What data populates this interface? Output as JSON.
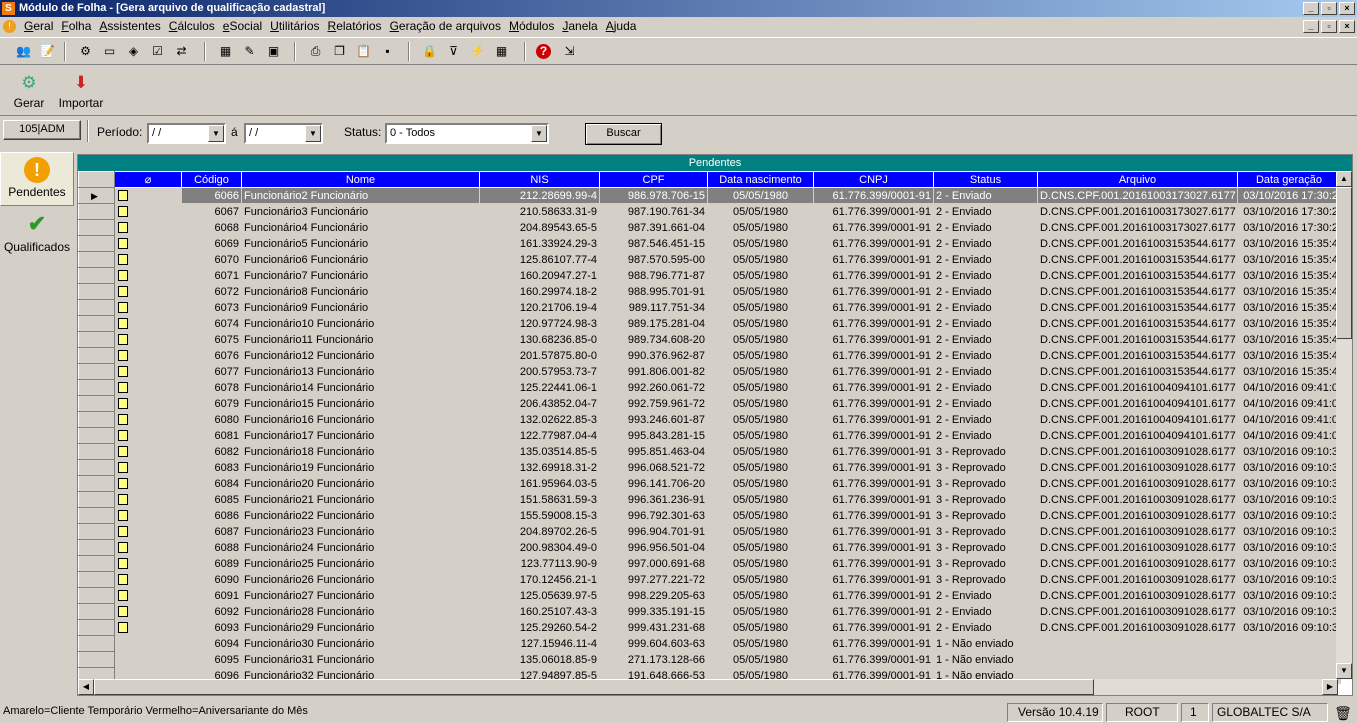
{
  "window": {
    "title": "Módulo de Folha - [Gera arquivo de qualificação cadastral]"
  },
  "menu": [
    "Geral",
    "Folha",
    "Assistentes",
    "Cálculos",
    "eSocial",
    "Utilitários",
    "Relatórios",
    "Geração de arquivos",
    "Módulos",
    "Janela",
    "Ajuda"
  ],
  "toolbar_icons": [
    "users-icon",
    "notes-icon",
    "settings-icon",
    "window-icon",
    "tag-icon",
    "check-doc-icon",
    "transfer-icon",
    "calendar-icon",
    "ruler-icon",
    "briefcase-icon",
    "printer-icon",
    "copy-icon",
    "paste-icon",
    "disk-icon",
    "lock-icon",
    "filter-icon",
    "lightning-icon",
    "grid-icon",
    "help-icon",
    "exit-icon"
  ],
  "actions": {
    "generate_label": "Gerar",
    "import_label": "Importar"
  },
  "filters": {
    "company_code": "105|ADM",
    "period_label": "Período:",
    "period_start": "/ /",
    "period_separator": "á",
    "period_end": "/ /",
    "status_label": "Status:",
    "status_value": "0 - Todos",
    "search_button": "Buscar"
  },
  "sidebar": {
    "pending_label": "Pendentes",
    "qualified_label": "Qualificados"
  },
  "grid": {
    "title": "Pendentes",
    "columns": [
      "Código",
      "Nome",
      "NIS",
      "CPF",
      "Data nascimento",
      "CNPJ",
      "Status",
      "Arquivo",
      "Data geração"
    ],
    "rows": [
      {
        "code": "6066",
        "name": "Funcionário2 Funcionário",
        "nis": "212.28699.99-4",
        "cpf": "986.978.706-15",
        "birth": "05/05/1980",
        "cnpj": "61.776.399/0001-91",
        "status": "2 - Enviado",
        "file": "D.CNS.CPF.001.20161003173027.6177",
        "gen": "03/10/2016 17:30:2",
        "icon": true
      },
      {
        "code": "6067",
        "name": "Funcionário3 Funcionário",
        "nis": "210.58633.31-9",
        "cpf": "987.190.761-34",
        "birth": "05/05/1980",
        "cnpj": "61.776.399/0001-91",
        "status": "2 - Enviado",
        "file": "D.CNS.CPF.001.20161003173027.6177",
        "gen": "03/10/2016 17:30:2",
        "icon": true
      },
      {
        "code": "6068",
        "name": "Funcionário4 Funcionário",
        "nis": "204.89543.65-5",
        "cpf": "987.391.661-04",
        "birth": "05/05/1980",
        "cnpj": "61.776.399/0001-91",
        "status": "2 - Enviado",
        "file": "D.CNS.CPF.001.20161003173027.6177",
        "gen": "03/10/2016 17:30:2",
        "icon": true
      },
      {
        "code": "6069",
        "name": "Funcionário5 Funcionário",
        "nis": "161.33924.29-3",
        "cpf": "987.546.451-15",
        "birth": "05/05/1980",
        "cnpj": "61.776.399/0001-91",
        "status": "2 - Enviado",
        "file": "D.CNS.CPF.001.20161003153544.6177",
        "gen": "03/10/2016 15:35:4",
        "icon": true
      },
      {
        "code": "6070",
        "name": "Funcionário6 Funcionário",
        "nis": "125.86107.77-4",
        "cpf": "987.570.595-00",
        "birth": "05/05/1980",
        "cnpj": "61.776.399/0001-91",
        "status": "2 - Enviado",
        "file": "D.CNS.CPF.001.20161003153544.6177",
        "gen": "03/10/2016 15:35:4",
        "icon": true
      },
      {
        "code": "6071",
        "name": "Funcionário7 Funcionário",
        "nis": "160.20947.27-1",
        "cpf": "988.796.771-87",
        "birth": "05/05/1980",
        "cnpj": "61.776.399/0001-91",
        "status": "2 - Enviado",
        "file": "D.CNS.CPF.001.20161003153544.6177",
        "gen": "03/10/2016 15:35:4",
        "icon": true
      },
      {
        "code": "6072",
        "name": "Funcionário8 Funcionário",
        "nis": "160.29974.18-2",
        "cpf": "988.995.701-91",
        "birth": "05/05/1980",
        "cnpj": "61.776.399/0001-91",
        "status": "2 - Enviado",
        "file": "D.CNS.CPF.001.20161003153544.6177",
        "gen": "03/10/2016 15:35:4",
        "icon": true
      },
      {
        "code": "6073",
        "name": "Funcionário9 Funcionário",
        "nis": "120.21706.19-4",
        "cpf": "989.117.751-34",
        "birth": "05/05/1980",
        "cnpj": "61.776.399/0001-91",
        "status": "2 - Enviado",
        "file": "D.CNS.CPF.001.20161003153544.6177",
        "gen": "03/10/2016 15:35:4",
        "icon": true
      },
      {
        "code": "6074",
        "name": "Funcionário10 Funcionário",
        "nis": "120.97724.98-3",
        "cpf": "989.175.281-04",
        "birth": "05/05/1980",
        "cnpj": "61.776.399/0001-91",
        "status": "2 - Enviado",
        "file": "D.CNS.CPF.001.20161003153544.6177",
        "gen": "03/10/2016 15:35:4",
        "icon": true
      },
      {
        "code": "6075",
        "name": "Funcionário11 Funcionário",
        "nis": "130.68236.85-0",
        "cpf": "989.734.608-20",
        "birth": "05/05/1980",
        "cnpj": "61.776.399/0001-91",
        "status": "2 - Enviado",
        "file": "D.CNS.CPF.001.20161003153544.6177",
        "gen": "03/10/2016 15:35:4",
        "icon": true
      },
      {
        "code": "6076",
        "name": "Funcionário12 Funcionário",
        "nis": "201.57875.80-0",
        "cpf": "990.376.962-87",
        "birth": "05/05/1980",
        "cnpj": "61.776.399/0001-91",
        "status": "2 - Enviado",
        "file": "D.CNS.CPF.001.20161003153544.6177",
        "gen": "03/10/2016 15:35:4",
        "icon": true
      },
      {
        "code": "6077",
        "name": "Funcionário13 Funcionário",
        "nis": "200.57953.73-7",
        "cpf": "991.806.001-82",
        "birth": "05/05/1980",
        "cnpj": "61.776.399/0001-91",
        "status": "2 - Enviado",
        "file": "D.CNS.CPF.001.20161003153544.6177",
        "gen": "03/10/2016 15:35:4",
        "icon": true
      },
      {
        "code": "6078",
        "name": "Funcionário14 Funcionário",
        "nis": "125.22441.06-1",
        "cpf": "992.260.061-72",
        "birth": "05/05/1980",
        "cnpj": "61.776.399/0001-91",
        "status": "2 - Enviado",
        "file": "D.CNS.CPF.001.20161004094101.6177",
        "gen": "04/10/2016 09:41:0",
        "icon": true
      },
      {
        "code": "6079",
        "name": "Funcionário15 Funcionário",
        "nis": "206.43852.04-7",
        "cpf": "992.759.961-72",
        "birth": "05/05/1980",
        "cnpj": "61.776.399/0001-91",
        "status": "2 - Enviado",
        "file": "D.CNS.CPF.001.20161004094101.6177",
        "gen": "04/10/2016 09:41:0",
        "icon": true
      },
      {
        "code": "6080",
        "name": "Funcionário16 Funcionário",
        "nis": "132.02622.85-3",
        "cpf": "993.246.601-87",
        "birth": "05/05/1980",
        "cnpj": "61.776.399/0001-91",
        "status": "2 - Enviado",
        "file": "D.CNS.CPF.001.20161004094101.6177",
        "gen": "04/10/2016 09:41:0",
        "icon": true
      },
      {
        "code": "6081",
        "name": "Funcionário17 Funcionário",
        "nis": "122.77987.04-4",
        "cpf": "995.843.281-15",
        "birth": "05/05/1980",
        "cnpj": "61.776.399/0001-91",
        "status": "2 - Enviado",
        "file": "D.CNS.CPF.001.20161004094101.6177",
        "gen": "04/10/2016 09:41:0",
        "icon": true
      },
      {
        "code": "6082",
        "name": "Funcionário18 Funcionário",
        "nis": "135.03514.85-5",
        "cpf": "995.851.463-04",
        "birth": "05/05/1980",
        "cnpj": "61.776.399/0001-91",
        "status": "3 - Reprovado",
        "file": "D.CNS.CPF.001.20161003091028.6177",
        "gen": "03/10/2016 09:10:3",
        "icon": true
      },
      {
        "code": "6083",
        "name": "Funcionário19 Funcionário",
        "nis": "132.69918.31-2",
        "cpf": "996.068.521-72",
        "birth": "05/05/1980",
        "cnpj": "61.776.399/0001-91",
        "status": "3 - Reprovado",
        "file": "D.CNS.CPF.001.20161003091028.6177",
        "gen": "03/10/2016 09:10:3",
        "icon": true
      },
      {
        "code": "6084",
        "name": "Funcionário20 Funcionário",
        "nis": "161.95964.03-5",
        "cpf": "996.141.706-20",
        "birth": "05/05/1980",
        "cnpj": "61.776.399/0001-91",
        "status": "3 - Reprovado",
        "file": "D.CNS.CPF.001.20161003091028.6177",
        "gen": "03/10/2016 09:10:3",
        "icon": true
      },
      {
        "code": "6085",
        "name": "Funcionário21 Funcionário",
        "nis": "151.58631.59-3",
        "cpf": "996.361.236-91",
        "birth": "05/05/1980",
        "cnpj": "61.776.399/0001-91",
        "status": "3 - Reprovado",
        "file": "D.CNS.CPF.001.20161003091028.6177",
        "gen": "03/10/2016 09:10:3",
        "icon": true
      },
      {
        "code": "6086",
        "name": "Funcionário22 Funcionário",
        "nis": "155.59008.15-3",
        "cpf": "996.792.301-63",
        "birth": "05/05/1980",
        "cnpj": "61.776.399/0001-91",
        "status": "3 - Reprovado",
        "file": "D.CNS.CPF.001.20161003091028.6177",
        "gen": "03/10/2016 09:10:3",
        "icon": true
      },
      {
        "code": "6087",
        "name": "Funcionário23 Funcionário",
        "nis": "204.89702.26-5",
        "cpf": "996.904.701-91",
        "birth": "05/05/1980",
        "cnpj": "61.776.399/0001-91",
        "status": "3 - Reprovado",
        "file": "D.CNS.CPF.001.20161003091028.6177",
        "gen": "03/10/2016 09:10:3",
        "icon": true
      },
      {
        "code": "6088",
        "name": "Funcionário24 Funcionário",
        "nis": "200.98304.49-0",
        "cpf": "996.956.501-04",
        "birth": "05/05/1980",
        "cnpj": "61.776.399/0001-91",
        "status": "3 - Reprovado",
        "file": "D.CNS.CPF.001.20161003091028.6177",
        "gen": "03/10/2016 09:10:3",
        "icon": true
      },
      {
        "code": "6089",
        "name": "Funcionário25 Funcionário",
        "nis": "123.77113.90-9",
        "cpf": "997.000.691-68",
        "birth": "05/05/1980",
        "cnpj": "61.776.399/0001-91",
        "status": "3 - Reprovado",
        "file": "D.CNS.CPF.001.20161003091028.6177",
        "gen": "03/10/2016 09:10:3",
        "icon": true
      },
      {
        "code": "6090",
        "name": "Funcionário26 Funcionário",
        "nis": "170.12456.21-1",
        "cpf": "997.277.221-72",
        "birth": "05/05/1980",
        "cnpj": "61.776.399/0001-91",
        "status": "3 - Reprovado",
        "file": "D.CNS.CPF.001.20161003091028.6177",
        "gen": "03/10/2016 09:10:3",
        "icon": true
      },
      {
        "code": "6091",
        "name": "Funcionário27 Funcionário",
        "nis": "125.05639.97-5",
        "cpf": "998.229.205-63",
        "birth": "05/05/1980",
        "cnpj": "61.776.399/0001-91",
        "status": "2 - Enviado",
        "file": "D.CNS.CPF.001.20161003091028.6177",
        "gen": "03/10/2016 09:10:3",
        "icon": true
      },
      {
        "code": "6092",
        "name": "Funcionário28 Funcionário",
        "nis": "160.25107.43-3",
        "cpf": "999.335.191-15",
        "birth": "05/05/1980",
        "cnpj": "61.776.399/0001-91",
        "status": "2 - Enviado",
        "file": "D.CNS.CPF.001.20161003091028.6177",
        "gen": "03/10/2016 09:10:3",
        "icon": true
      },
      {
        "code": "6093",
        "name": "Funcionário29 Funcionário",
        "nis": "125.29260.54-2",
        "cpf": "999.431.231-68",
        "birth": "05/05/1980",
        "cnpj": "61.776.399/0001-91",
        "status": "2 - Enviado",
        "file": "D.CNS.CPF.001.20161003091028.6177",
        "gen": "03/10/2016 09:10:3",
        "icon": true
      },
      {
        "code": "6094",
        "name": "Funcionário30 Funcionário",
        "nis": "127.15946.11-4",
        "cpf": "999.604.603-63",
        "birth": "05/05/1980",
        "cnpj": "61.776.399/0001-91",
        "status": "1 - Não enviado",
        "file": "",
        "gen": "",
        "icon": false
      },
      {
        "code": "6095",
        "name": "Funcionário31 Funcionário",
        "nis": "135.06018.85-9",
        "cpf": "271.173.128-66",
        "birth": "05/05/1980",
        "cnpj": "61.776.399/0001-91",
        "status": "1 - Não enviado",
        "file": "",
        "gen": "",
        "icon": false
      },
      {
        "code": "6096",
        "name": "Funcionário32 Funcionário",
        "nis": "127.94897.85-5",
        "cpf": "191.648.666-53",
        "birth": "05/05/1980",
        "cnpj": "61.776.399/0001-91",
        "status": "1 - Não enviado",
        "file": "",
        "gen": "",
        "icon": false
      }
    ]
  },
  "status_bar": {
    "legend": "Amarelo=Cliente Temporário  Vermelho=Aniversariante do Mês",
    "version": "Versão 10.4.19",
    "user": "ROOT",
    "number": "1",
    "company": "GLOBALTEC S/A"
  }
}
